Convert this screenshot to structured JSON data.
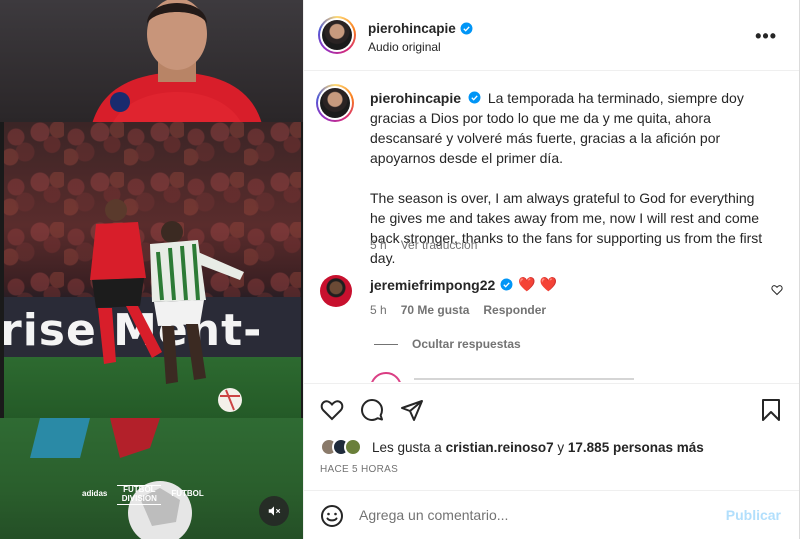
{
  "post": {
    "username": "pierohincapie",
    "audio": "Audio original",
    "caption_es": "La temporada ha terminado, siempre doy gracias a Dios por todo lo que me da y me quita, ahora descansaré y volveré más fuerte, gracias a la afición por apoyarnos desde el primer día.",
    "caption_en": "The season is over, I am always grateful to God for everything he gives me and takes away from me, now I will rest and come back stronger, thanks to the fans for supporting us from the first day.",
    "caption_age": "5 h",
    "translate_label": "Ver traducción"
  },
  "media": {
    "board_text": "rise  Ment-",
    "logos": [
      "adidas",
      "FUTBOL DIVISION",
      "FUTBOL"
    ]
  },
  "comment": {
    "username": "jeremiefrimpong22",
    "text": "❤️ ❤️",
    "age": "5 h",
    "likes": "70 Me gusta",
    "reply_label": "Responder",
    "hide_replies_label": "Ocultar respuestas"
  },
  "likes_line": {
    "prefix": "Les gusta a",
    "user": "cristian.reinoso7",
    "mid": "y",
    "count": "17.885 personas más"
  },
  "timestamp": "HACE 5 HORAS",
  "composer": {
    "placeholder": "Agrega un comentario...",
    "publish_label": "Publicar"
  },
  "colors": {
    "verified": "#0095f6",
    "heart": "#ff3040",
    "publish_disabled": "#b2dffc"
  },
  "icons": [
    "more-options-icon",
    "verified-badge-icon",
    "heart-icon",
    "comment-icon",
    "share-icon",
    "bookmark-icon",
    "emoji-icon",
    "mute-icon"
  ]
}
